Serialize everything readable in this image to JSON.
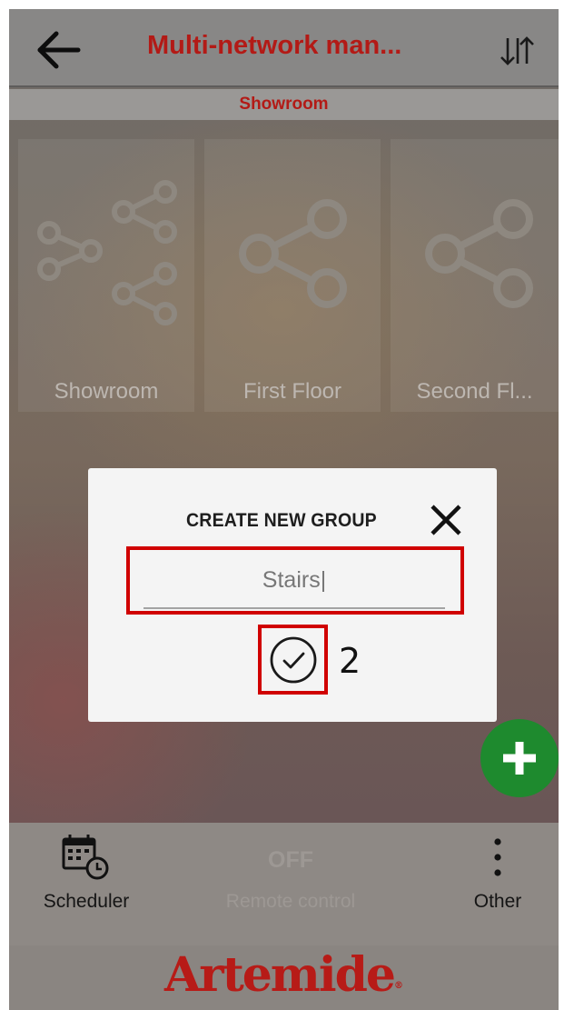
{
  "header": {
    "title": "Multi-network man...",
    "back_icon": "arrow-left-icon",
    "sort_icon": "sort-arrows-icon"
  },
  "subheader": {
    "label": "Showroom"
  },
  "networks": [
    {
      "label": "Showroom",
      "icon": "multi-share-icon"
    },
    {
      "label": "First Floor",
      "icon": "share-icon"
    },
    {
      "label": "Second Fl...",
      "icon": "share-icon"
    }
  ],
  "dialog": {
    "title": "CREATE NEW GROUP",
    "input_value": "Stairs|",
    "confirm_icon": "check-circle-icon",
    "close_icon": "close-icon",
    "step_label": "2"
  },
  "fab": {
    "icon": "plus-icon"
  },
  "bottom_bar": {
    "scheduler_label": "Scheduler",
    "remote_off_label": "OFF",
    "remote_label": "Remote control",
    "other_label": "Other"
  },
  "footer": {
    "logo": "Artemide",
    "registered": "®"
  },
  "colors": {
    "brand_red": "#b31a16",
    "highlight_red": "#d00000",
    "fab_green": "#1e8a2e"
  }
}
